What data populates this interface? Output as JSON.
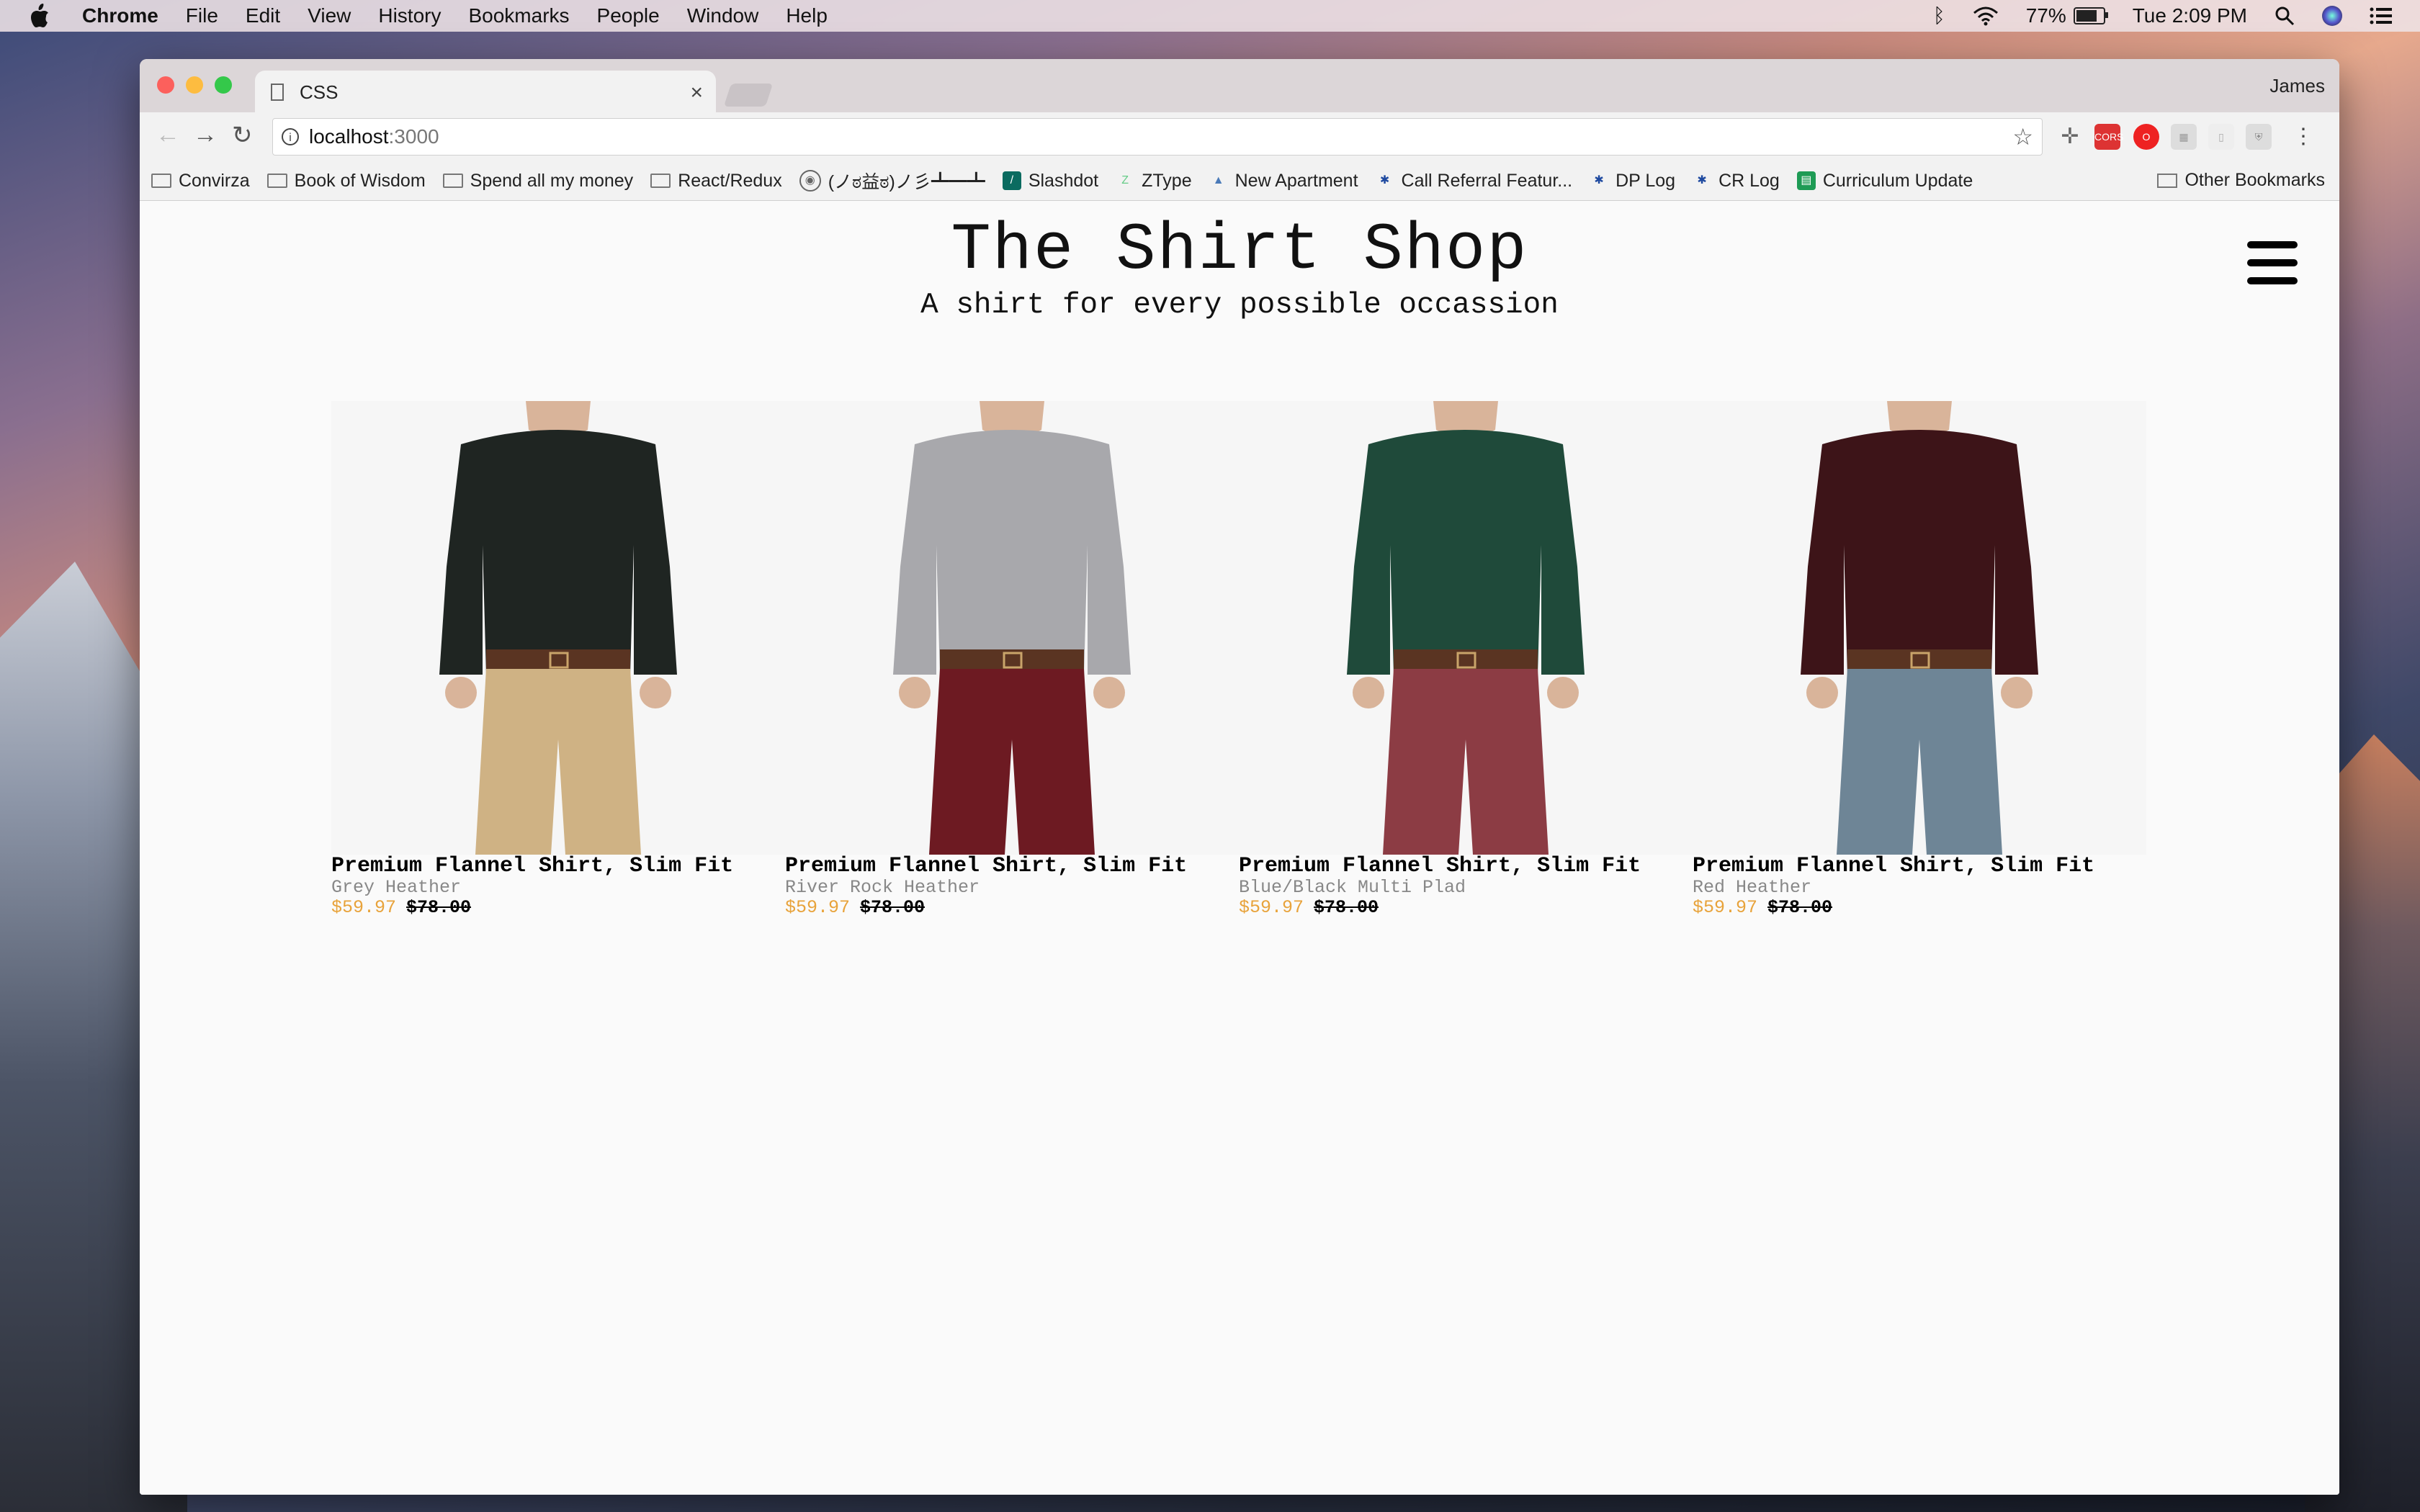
{
  "menubar": {
    "app": "Chrome",
    "items": [
      "File",
      "Edit",
      "View",
      "History",
      "Bookmarks",
      "People",
      "Window",
      "Help"
    ],
    "battery": "77%",
    "clock": "Tue 2:09 PM"
  },
  "browser": {
    "tab_title": "CSS",
    "profile": "James",
    "url_host": "localhost",
    "url_port": ":3000",
    "bookmarks": [
      {
        "label": "Convirza",
        "icon": "folder-icon"
      },
      {
        "label": "Book of Wisdom",
        "icon": "folder-icon"
      },
      {
        "label": "Spend all my money",
        "icon": "folder-icon"
      },
      {
        "label": "React/Redux",
        "icon": "folder-icon"
      },
      {
        "label": "(ノಠ益ಠ)ノ彡┻━┻",
        "icon": "globe-icon"
      },
      {
        "label": "Slashdot",
        "icon": "slashdot-icon"
      },
      {
        "label": "ZType",
        "icon": "ztype-icon"
      },
      {
        "label": "New Apartment",
        "icon": "apartment-icon"
      },
      {
        "label": "Call Referral Featur...",
        "icon": "jira-icon"
      },
      {
        "label": "DP Log",
        "icon": "jira-icon"
      },
      {
        "label": "CR Log",
        "icon": "jira-icon"
      },
      {
        "label": "Curriculum Update",
        "icon": "sheets-icon"
      }
    ],
    "other_bookmarks": "Other Bookmarks"
  },
  "page": {
    "title": "The Shirt Shop",
    "subtitle": "A shirt for every possible occassion",
    "products": [
      {
        "name": "Premium Flannel Shirt, Slim Fit",
        "color": "Grey Heather",
        "sale_price": "$59.97",
        "original_price": "$78.00",
        "shirt_color": "#1f2522",
        "pants_color": "#cfb284"
      },
      {
        "name": "Premium Flannel Shirt, Slim Fit",
        "color": "River Rock Heather",
        "sale_price": "$59.97",
        "original_price": "$78.00",
        "shirt_color": "#a8a8ac",
        "pants_color": "#6d1a22"
      },
      {
        "name": "Premium Flannel Shirt, Slim Fit",
        "color": "Blue/Black Multi Plad",
        "sale_price": "$59.97",
        "original_price": "$78.00",
        "shirt_color": "#1f4a3a",
        "pants_color": "#8c3c44"
      },
      {
        "name": "Premium Flannel Shirt, Slim Fit",
        "color": "Red Heather",
        "sale_price": "$59.97",
        "original_price": "$78.00",
        "shirt_color": "#3d1418",
        "pants_color": "#6e8596"
      }
    ]
  }
}
